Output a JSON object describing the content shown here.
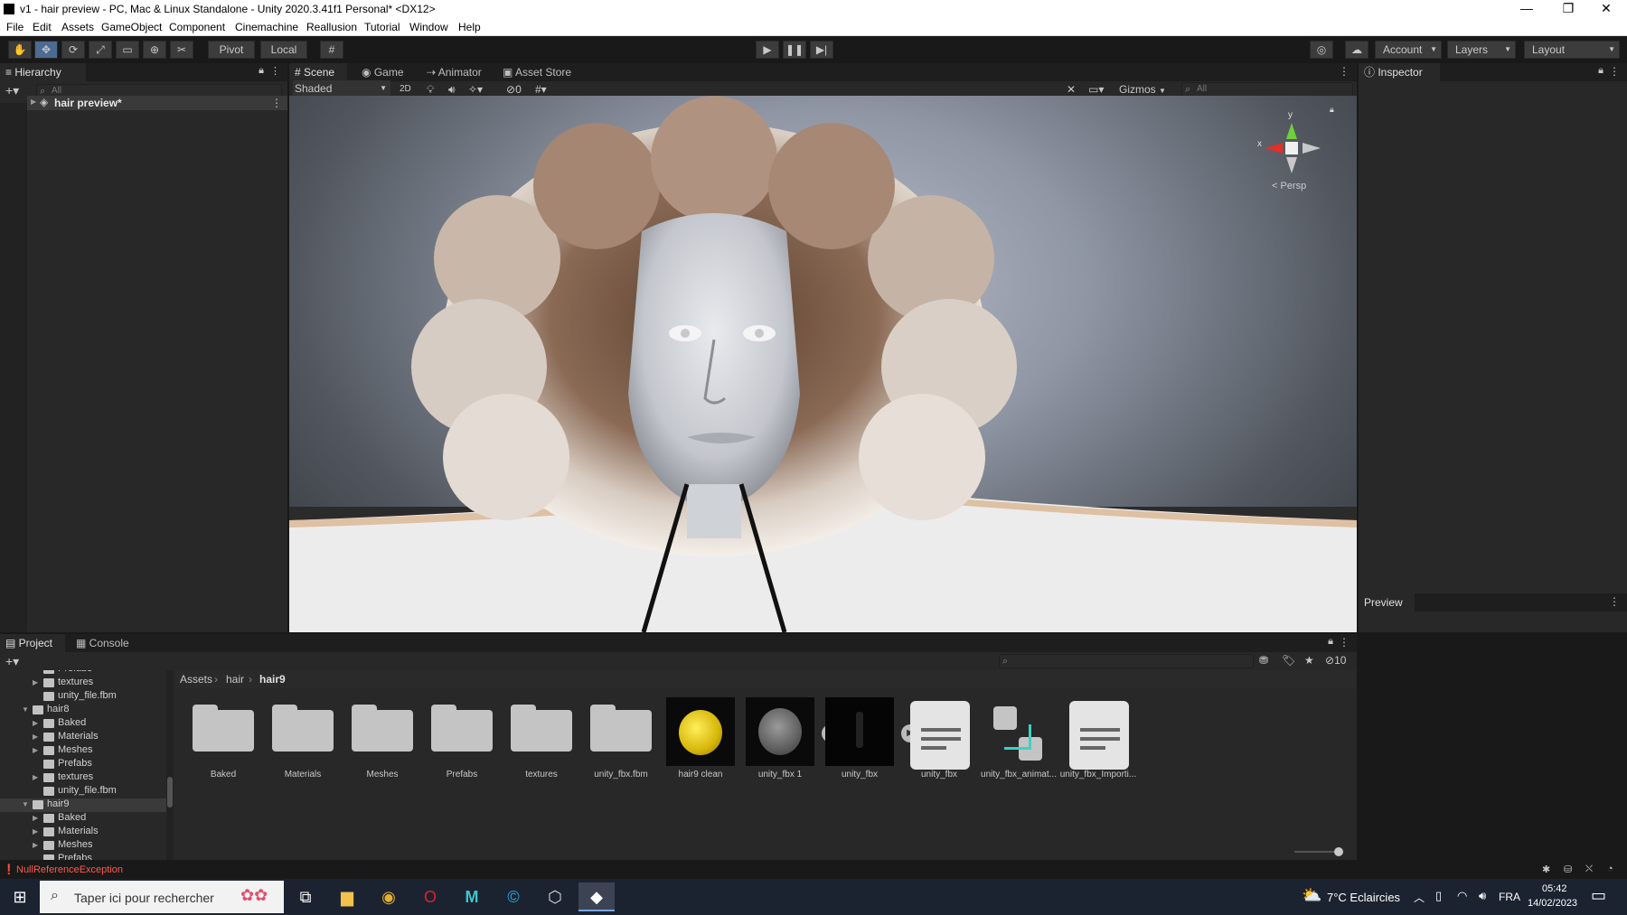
{
  "window": {
    "title": "v1 - hair preview - PC, Mac & Linux Standalone - Unity 2020.3.41f1 Personal* <DX12>"
  },
  "menu": [
    "File",
    "Edit",
    "Assets",
    "GameObject",
    "Component",
    "Cinemachine",
    "Reallusion",
    "Tutorial",
    "Window",
    "Help"
  ],
  "toolbar": {
    "pivot": "Pivot",
    "local": "Local",
    "account": "Account",
    "layers": "Layers",
    "layout": "Layout"
  },
  "hierarchy": {
    "tab": "Hierarchy",
    "search_placeholder": "All",
    "scene_item": "hair preview*"
  },
  "scene": {
    "tabs": [
      "Scene",
      "Game",
      "Animator",
      "Asset Store"
    ],
    "shading": "Shaded",
    "mode_2d": "2D",
    "hidden_count": "0",
    "gizmos": "Gizmos",
    "search_placeholder": "All",
    "gizmo_y": "y",
    "gizmo_x": "x",
    "persp": "< Persp"
  },
  "inspector": {
    "tab": "Inspector",
    "preview": "Preview"
  },
  "project": {
    "tabs": [
      "Project",
      "Console"
    ],
    "count": "10",
    "breadcrumb": [
      "Assets",
      "hair",
      "hair9"
    ],
    "tree": [
      {
        "label": "Prefabs",
        "indent": 2,
        "type": "folder",
        "expand": ""
      },
      {
        "label": "textures",
        "indent": 2,
        "type": "folder",
        "expand": "▶"
      },
      {
        "label": "unity_file.fbm",
        "indent": 2,
        "type": "folder",
        "expand": ""
      },
      {
        "label": "hair8",
        "indent": 1,
        "type": "folder",
        "expand": "▼"
      },
      {
        "label": "Baked",
        "indent": 2,
        "type": "folder",
        "expand": "▶"
      },
      {
        "label": "Materials",
        "indent": 2,
        "type": "folder",
        "expand": "▶"
      },
      {
        "label": "Meshes",
        "indent": 2,
        "type": "folder",
        "expand": "▶"
      },
      {
        "label": "Prefabs",
        "indent": 2,
        "type": "folder",
        "expand": ""
      },
      {
        "label": "textures",
        "indent": 2,
        "type": "folder",
        "expand": "▶"
      },
      {
        "label": "unity_file.fbm",
        "indent": 2,
        "type": "folder",
        "expand": ""
      },
      {
        "label": "hair9",
        "indent": 1,
        "type": "folder",
        "expand": "▼"
      },
      {
        "label": "Baked",
        "indent": 2,
        "type": "folder",
        "expand": "▶"
      },
      {
        "label": "Materials",
        "indent": 2,
        "type": "folder",
        "expand": "▶"
      },
      {
        "label": "Meshes",
        "indent": 2,
        "type": "folder",
        "expand": "▶"
      },
      {
        "label": "Prefabs",
        "indent": 2,
        "type": "folder",
        "expand": ""
      }
    ],
    "assets": [
      {
        "label": "Baked",
        "kind": "folder"
      },
      {
        "label": "Materials",
        "kind": "folder"
      },
      {
        "label": "Meshes",
        "kind": "folder"
      },
      {
        "label": "Prefabs",
        "kind": "folder"
      },
      {
        "label": "textures",
        "kind": "folder"
      },
      {
        "label": "unity_fbx.fbm",
        "kind": "folder"
      },
      {
        "label": "hair9 clean",
        "kind": "material-yellow"
      },
      {
        "label": "unity_fbx 1",
        "kind": "model-grey"
      },
      {
        "label": "unity_fbx",
        "kind": "model-dark"
      },
      {
        "label": "unity_fbx",
        "kind": "doc"
      },
      {
        "label": "unity_fbx_animat...",
        "kind": "animator"
      },
      {
        "label": "unity_fbx_Importi...",
        "kind": "doc"
      }
    ]
  },
  "status": {
    "error": "NullReferenceException"
  },
  "taskbar": {
    "search": "Taper ici pour rechercher",
    "weather": "7°C  Eclaircies",
    "lang": "FRA",
    "time": "05:42",
    "date": "14/02/2023"
  },
  "colors": {
    "accent": "#4b6b92",
    "error": "#ff5a4f",
    "unity_dark": "#282828"
  }
}
